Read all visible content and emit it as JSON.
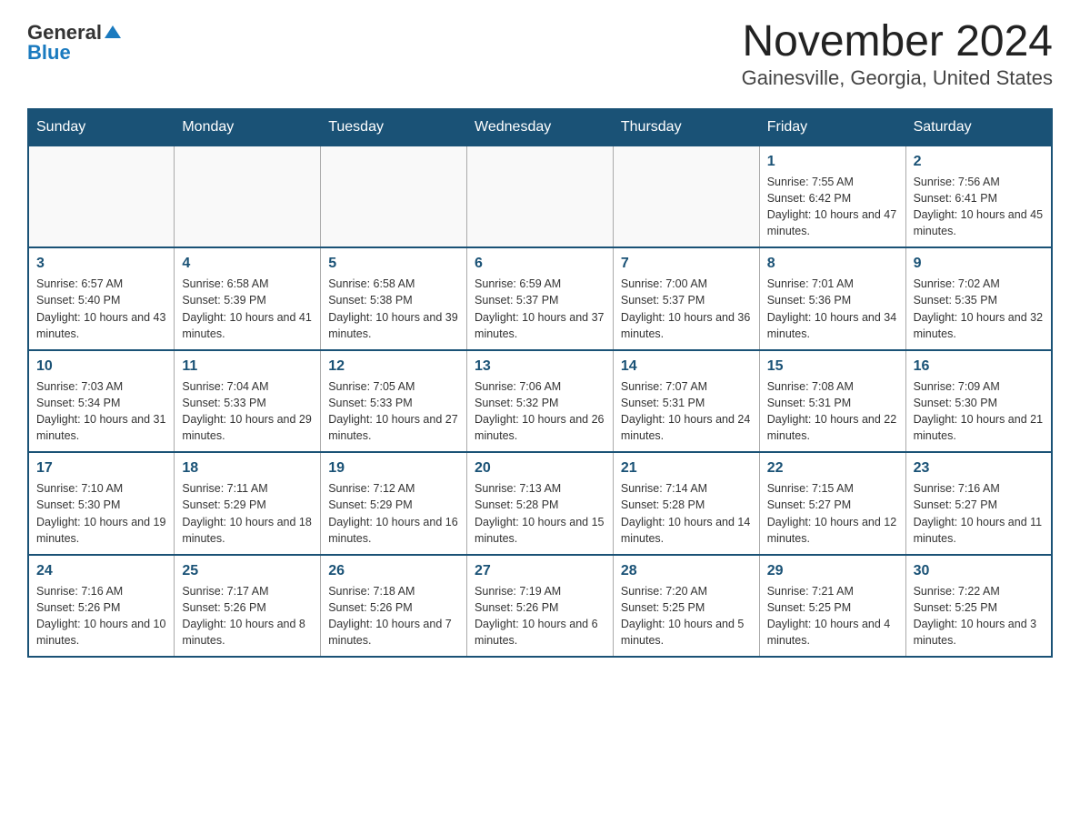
{
  "logo": {
    "general": "General",
    "blue": "Blue",
    "arrow": "▲"
  },
  "title": "November 2024",
  "subtitle": "Gainesville, Georgia, United States",
  "days_header": [
    "Sunday",
    "Monday",
    "Tuesday",
    "Wednesday",
    "Thursday",
    "Friday",
    "Saturday"
  ],
  "weeks": [
    [
      {
        "day": "",
        "info": ""
      },
      {
        "day": "",
        "info": ""
      },
      {
        "day": "",
        "info": ""
      },
      {
        "day": "",
        "info": ""
      },
      {
        "day": "",
        "info": ""
      },
      {
        "day": "1",
        "info": "Sunrise: 7:55 AM\nSunset: 6:42 PM\nDaylight: 10 hours and 47 minutes."
      },
      {
        "day": "2",
        "info": "Sunrise: 7:56 AM\nSunset: 6:41 PM\nDaylight: 10 hours and 45 minutes."
      }
    ],
    [
      {
        "day": "3",
        "info": "Sunrise: 6:57 AM\nSunset: 5:40 PM\nDaylight: 10 hours and 43 minutes."
      },
      {
        "day": "4",
        "info": "Sunrise: 6:58 AM\nSunset: 5:39 PM\nDaylight: 10 hours and 41 minutes."
      },
      {
        "day": "5",
        "info": "Sunrise: 6:58 AM\nSunset: 5:38 PM\nDaylight: 10 hours and 39 minutes."
      },
      {
        "day": "6",
        "info": "Sunrise: 6:59 AM\nSunset: 5:37 PM\nDaylight: 10 hours and 37 minutes."
      },
      {
        "day": "7",
        "info": "Sunrise: 7:00 AM\nSunset: 5:37 PM\nDaylight: 10 hours and 36 minutes."
      },
      {
        "day": "8",
        "info": "Sunrise: 7:01 AM\nSunset: 5:36 PM\nDaylight: 10 hours and 34 minutes."
      },
      {
        "day": "9",
        "info": "Sunrise: 7:02 AM\nSunset: 5:35 PM\nDaylight: 10 hours and 32 minutes."
      }
    ],
    [
      {
        "day": "10",
        "info": "Sunrise: 7:03 AM\nSunset: 5:34 PM\nDaylight: 10 hours and 31 minutes."
      },
      {
        "day": "11",
        "info": "Sunrise: 7:04 AM\nSunset: 5:33 PM\nDaylight: 10 hours and 29 minutes."
      },
      {
        "day": "12",
        "info": "Sunrise: 7:05 AM\nSunset: 5:33 PM\nDaylight: 10 hours and 27 minutes."
      },
      {
        "day": "13",
        "info": "Sunrise: 7:06 AM\nSunset: 5:32 PM\nDaylight: 10 hours and 26 minutes."
      },
      {
        "day": "14",
        "info": "Sunrise: 7:07 AM\nSunset: 5:31 PM\nDaylight: 10 hours and 24 minutes."
      },
      {
        "day": "15",
        "info": "Sunrise: 7:08 AM\nSunset: 5:31 PM\nDaylight: 10 hours and 22 minutes."
      },
      {
        "day": "16",
        "info": "Sunrise: 7:09 AM\nSunset: 5:30 PM\nDaylight: 10 hours and 21 minutes."
      }
    ],
    [
      {
        "day": "17",
        "info": "Sunrise: 7:10 AM\nSunset: 5:30 PM\nDaylight: 10 hours and 19 minutes."
      },
      {
        "day": "18",
        "info": "Sunrise: 7:11 AM\nSunset: 5:29 PM\nDaylight: 10 hours and 18 minutes."
      },
      {
        "day": "19",
        "info": "Sunrise: 7:12 AM\nSunset: 5:29 PM\nDaylight: 10 hours and 16 minutes."
      },
      {
        "day": "20",
        "info": "Sunrise: 7:13 AM\nSunset: 5:28 PM\nDaylight: 10 hours and 15 minutes."
      },
      {
        "day": "21",
        "info": "Sunrise: 7:14 AM\nSunset: 5:28 PM\nDaylight: 10 hours and 14 minutes."
      },
      {
        "day": "22",
        "info": "Sunrise: 7:15 AM\nSunset: 5:27 PM\nDaylight: 10 hours and 12 minutes."
      },
      {
        "day": "23",
        "info": "Sunrise: 7:16 AM\nSunset: 5:27 PM\nDaylight: 10 hours and 11 minutes."
      }
    ],
    [
      {
        "day": "24",
        "info": "Sunrise: 7:16 AM\nSunset: 5:26 PM\nDaylight: 10 hours and 10 minutes."
      },
      {
        "day": "25",
        "info": "Sunrise: 7:17 AM\nSunset: 5:26 PM\nDaylight: 10 hours and 8 minutes."
      },
      {
        "day": "26",
        "info": "Sunrise: 7:18 AM\nSunset: 5:26 PM\nDaylight: 10 hours and 7 minutes."
      },
      {
        "day": "27",
        "info": "Sunrise: 7:19 AM\nSunset: 5:26 PM\nDaylight: 10 hours and 6 minutes."
      },
      {
        "day": "28",
        "info": "Sunrise: 7:20 AM\nSunset: 5:25 PM\nDaylight: 10 hours and 5 minutes."
      },
      {
        "day": "29",
        "info": "Sunrise: 7:21 AM\nSunset: 5:25 PM\nDaylight: 10 hours and 4 minutes."
      },
      {
        "day": "30",
        "info": "Sunrise: 7:22 AM\nSunset: 5:25 PM\nDaylight: 10 hours and 3 minutes."
      }
    ]
  ]
}
